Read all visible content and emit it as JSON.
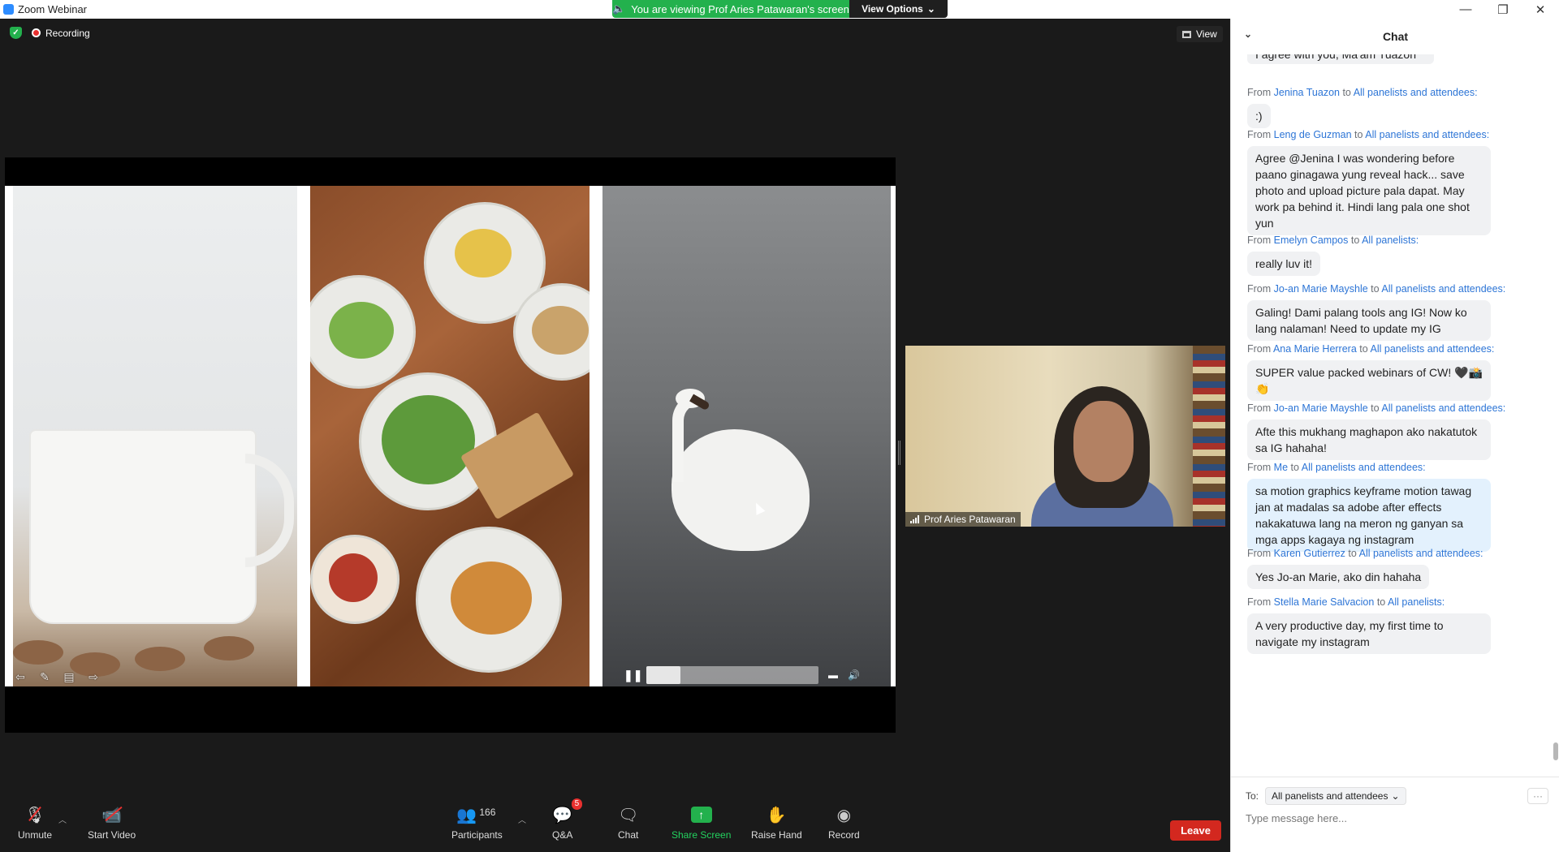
{
  "window": {
    "title": "Zoom Webinar",
    "minimize_icon": "minimize-icon",
    "restore_icon": "restore-icon",
    "close_icon": "close-icon"
  },
  "banner": {
    "viewing_text": "You are viewing Prof Aries Patawaran's screen",
    "view_options_label": "View Options"
  },
  "meeting": {
    "recording_label": "Recording",
    "view_label": "View"
  },
  "video_player": {
    "progress": 0.2
  },
  "speaker": {
    "name": "Prof Aries Patawaran"
  },
  "toolbar": {
    "unmute_label": "Unmute",
    "start_video_label": "Start Video",
    "participants_label": "Participants",
    "participants_count": "166",
    "qa_label": "Q&A",
    "qa_badge": "5",
    "chat_label": "Chat",
    "share_screen_label": "Share Screen",
    "raise_hand_label": "Raise Hand",
    "record_label": "Record",
    "leave_label": "Leave",
    "accent_green": "#23b14d",
    "leave_red": "#d3281f"
  },
  "chat": {
    "title": "Chat",
    "partial_message": "I agree with you, Ma'am Tuazon",
    "from_word": "From",
    "to_word": "to",
    "messages": [
      {
        "sender": "Jenina Tuazon",
        "recipient": "All panelists and attendees:",
        "text": ":)"
      },
      {
        "sender": "Leng de Guzman",
        "recipient": "All panelists and attendees:",
        "text": "Agree @Jenina I was wondering before paano ginagawa yung reveal hack... save photo and upload picture pala dapat. May work pa behind it. Hindi lang pala one shot yun"
      },
      {
        "sender": "Emelyn Campos",
        "recipient": "All panelists:",
        "text": "really luv it!"
      },
      {
        "sender": "Jo-an  Marie Mayshle",
        "recipient": "All panelists and attendees:",
        "text": "Galing! Dami palang tools ang IG! Now ko lang nalaman! Need to update my IG"
      },
      {
        "sender": "Ana Marie Herrera",
        "recipient": "All panelists and attendees:",
        "text": "SUPER value packed webinars of CW! 🖤📸👏"
      },
      {
        "sender": "Jo-an  Marie Mayshle",
        "recipient": "All panelists and attendees:",
        "text": "Afte this mukhang maghapon ako nakatutok sa IG hahaha!"
      },
      {
        "sender": "Me",
        "recipient": "All panelists and attendees:",
        "text": "sa motion graphics keyframe motion tawag jan at madalas sa adobe after effects nakakatuwa lang na meron ng ganyan sa mga apps kagaya ng instagram"
      },
      {
        "sender": "Karen Gutierrez",
        "recipient": "All panelists and attendees:",
        "text": "Yes Jo-an Marie, ako din hahaha"
      },
      {
        "sender": "Stella Marie Salvacion",
        "recipient": "All panelists:",
        "text": "A very productive day, my first time to navigate my instagram"
      }
    ],
    "to_label": "To:",
    "to_value": "All panelists and attendees",
    "input_placeholder": "Type message here...",
    "more_label": "···"
  }
}
